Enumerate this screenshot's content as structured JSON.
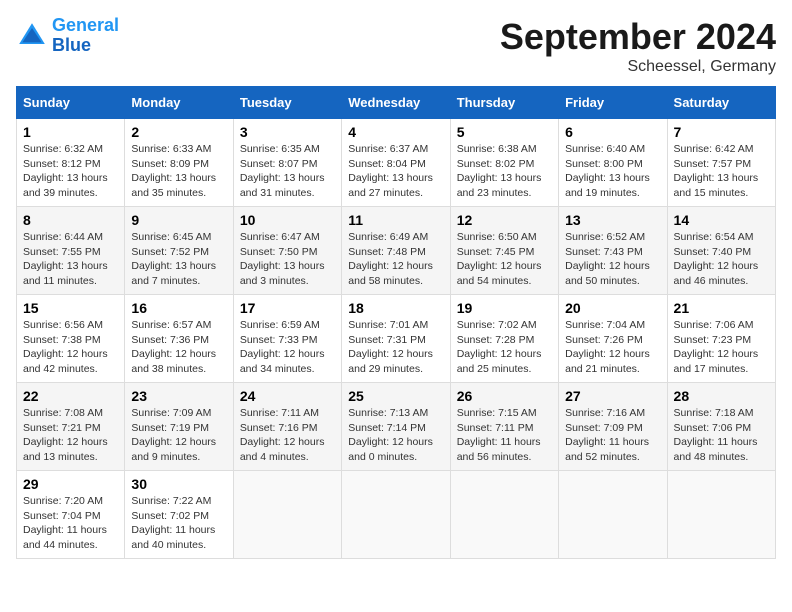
{
  "logo": {
    "line1": "General",
    "line2": "Blue"
  },
  "title": "September 2024",
  "subtitle": "Scheessel, Germany",
  "headers": [
    "Sunday",
    "Monday",
    "Tuesday",
    "Wednesday",
    "Thursday",
    "Friday",
    "Saturday"
  ],
  "weeks": [
    [
      {
        "day": "1",
        "sunrise": "6:32 AM",
        "sunset": "8:12 PM",
        "daylight": "13 hours and 39 minutes."
      },
      {
        "day": "2",
        "sunrise": "6:33 AM",
        "sunset": "8:09 PM",
        "daylight": "13 hours and 35 minutes."
      },
      {
        "day": "3",
        "sunrise": "6:35 AM",
        "sunset": "8:07 PM",
        "daylight": "13 hours and 31 minutes."
      },
      {
        "day": "4",
        "sunrise": "6:37 AM",
        "sunset": "8:04 PM",
        "daylight": "13 hours and 27 minutes."
      },
      {
        "day": "5",
        "sunrise": "6:38 AM",
        "sunset": "8:02 PM",
        "daylight": "13 hours and 23 minutes."
      },
      {
        "day": "6",
        "sunrise": "6:40 AM",
        "sunset": "8:00 PM",
        "daylight": "13 hours and 19 minutes."
      },
      {
        "day": "7",
        "sunrise": "6:42 AM",
        "sunset": "7:57 PM",
        "daylight": "13 hours and 15 minutes."
      }
    ],
    [
      {
        "day": "8",
        "sunrise": "6:44 AM",
        "sunset": "7:55 PM",
        "daylight": "13 hours and 11 minutes."
      },
      {
        "day": "9",
        "sunrise": "6:45 AM",
        "sunset": "7:52 PM",
        "daylight": "13 hours and 7 minutes."
      },
      {
        "day": "10",
        "sunrise": "6:47 AM",
        "sunset": "7:50 PM",
        "daylight": "13 hours and 3 minutes."
      },
      {
        "day": "11",
        "sunrise": "6:49 AM",
        "sunset": "7:48 PM",
        "daylight": "12 hours and 58 minutes."
      },
      {
        "day": "12",
        "sunrise": "6:50 AM",
        "sunset": "7:45 PM",
        "daylight": "12 hours and 54 minutes."
      },
      {
        "day": "13",
        "sunrise": "6:52 AM",
        "sunset": "7:43 PM",
        "daylight": "12 hours and 50 minutes."
      },
      {
        "day": "14",
        "sunrise": "6:54 AM",
        "sunset": "7:40 PM",
        "daylight": "12 hours and 46 minutes."
      }
    ],
    [
      {
        "day": "15",
        "sunrise": "6:56 AM",
        "sunset": "7:38 PM",
        "daylight": "12 hours and 42 minutes."
      },
      {
        "day": "16",
        "sunrise": "6:57 AM",
        "sunset": "7:36 PM",
        "daylight": "12 hours and 38 minutes."
      },
      {
        "day": "17",
        "sunrise": "6:59 AM",
        "sunset": "7:33 PM",
        "daylight": "12 hours and 34 minutes."
      },
      {
        "day": "18",
        "sunrise": "7:01 AM",
        "sunset": "7:31 PM",
        "daylight": "12 hours and 29 minutes."
      },
      {
        "day": "19",
        "sunrise": "7:02 AM",
        "sunset": "7:28 PM",
        "daylight": "12 hours and 25 minutes."
      },
      {
        "day": "20",
        "sunrise": "7:04 AM",
        "sunset": "7:26 PM",
        "daylight": "12 hours and 21 minutes."
      },
      {
        "day": "21",
        "sunrise": "7:06 AM",
        "sunset": "7:23 PM",
        "daylight": "12 hours and 17 minutes."
      }
    ],
    [
      {
        "day": "22",
        "sunrise": "7:08 AM",
        "sunset": "7:21 PM",
        "daylight": "12 hours and 13 minutes."
      },
      {
        "day": "23",
        "sunrise": "7:09 AM",
        "sunset": "7:19 PM",
        "daylight": "12 hours and 9 minutes."
      },
      {
        "day": "24",
        "sunrise": "7:11 AM",
        "sunset": "7:16 PM",
        "daylight": "12 hours and 4 minutes."
      },
      {
        "day": "25",
        "sunrise": "7:13 AM",
        "sunset": "7:14 PM",
        "daylight": "12 hours and 0 minutes."
      },
      {
        "day": "26",
        "sunrise": "7:15 AM",
        "sunset": "7:11 PM",
        "daylight": "11 hours and 56 minutes."
      },
      {
        "day": "27",
        "sunrise": "7:16 AM",
        "sunset": "7:09 PM",
        "daylight": "11 hours and 52 minutes."
      },
      {
        "day": "28",
        "sunrise": "7:18 AM",
        "sunset": "7:06 PM",
        "daylight": "11 hours and 48 minutes."
      }
    ],
    [
      {
        "day": "29",
        "sunrise": "7:20 AM",
        "sunset": "7:04 PM",
        "daylight": "11 hours and 44 minutes."
      },
      {
        "day": "30",
        "sunrise": "7:22 AM",
        "sunset": "7:02 PM",
        "daylight": "11 hours and 40 minutes."
      },
      null,
      null,
      null,
      null,
      null
    ]
  ],
  "labels": {
    "sunrise": "Sunrise:",
    "sunset": "Sunset:",
    "daylight": "Daylight hours"
  }
}
